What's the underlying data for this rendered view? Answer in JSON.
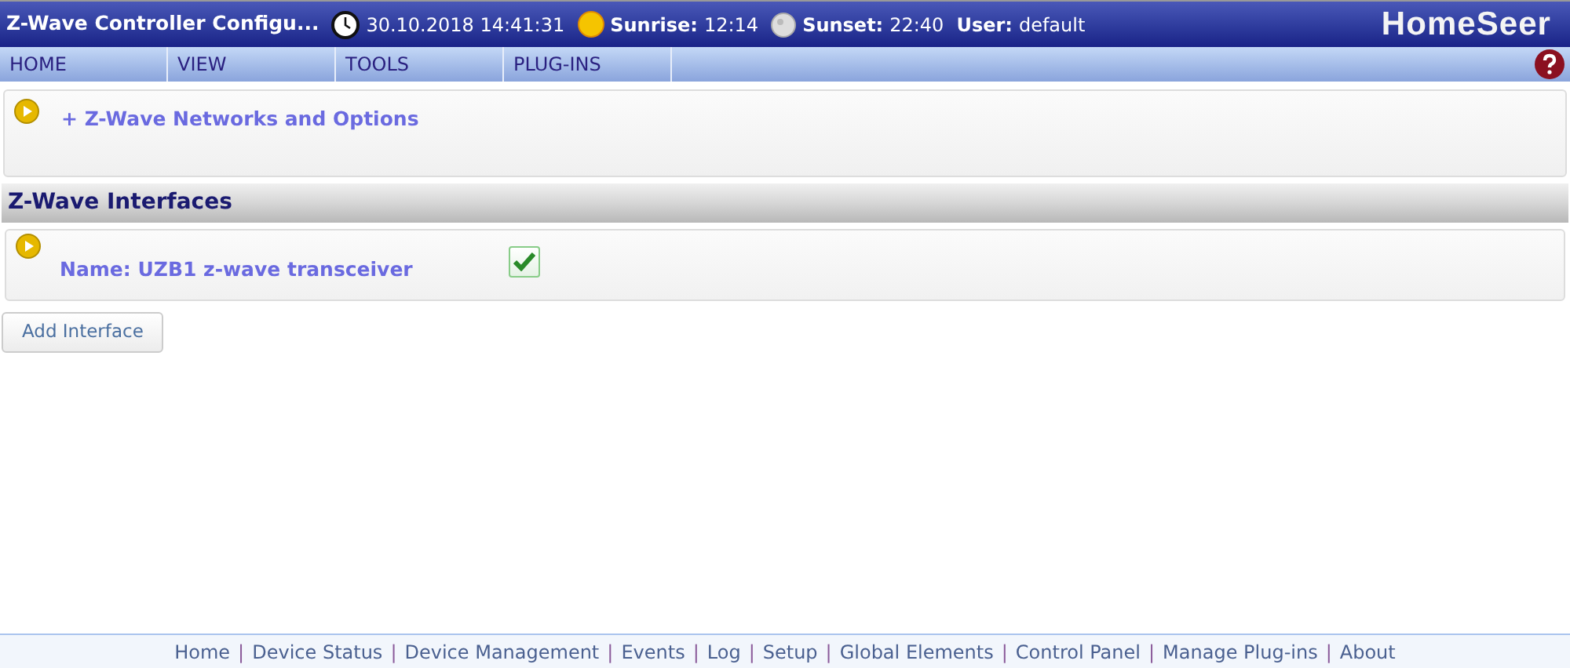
{
  "header": {
    "title": "Z-Wave Controller Configu...",
    "datetime": "30.10.2018 14:41:31",
    "sunrise_label": "Sunrise:",
    "sunrise": "12:14",
    "sunset_label": "Sunset:",
    "sunset": "22:40",
    "user_label": "User:",
    "user": "default",
    "logo": "HomeSeer"
  },
  "menu": [
    {
      "label": "HOME"
    },
    {
      "label": "VIEW"
    },
    {
      "label": "TOOLS"
    },
    {
      "label": "PLUG-INS"
    }
  ],
  "networks_panel": {
    "title": "+ Z-Wave Networks and Options"
  },
  "interfaces_section": {
    "title": "Z-Wave Interfaces"
  },
  "interfaces": [
    {
      "name": "Name: UZB1 z-wave transceiver",
      "checked": true
    }
  ],
  "add_button": "Add Interface",
  "footer": [
    {
      "kind": "link",
      "label": "Home"
    },
    {
      "kind": "separator",
      "label": "|"
    },
    {
      "kind": "link",
      "label": "Device Status"
    },
    {
      "kind": "separator",
      "label": "|"
    },
    {
      "kind": "link",
      "label": "Device Management"
    },
    {
      "kind": "separator",
      "label": "|"
    },
    {
      "kind": "link",
      "label": "Events"
    },
    {
      "kind": "separator",
      "label": "|"
    },
    {
      "kind": "link",
      "label": "Log"
    },
    {
      "kind": "separator",
      "label": "|"
    },
    {
      "kind": "link",
      "label": "Setup"
    },
    {
      "kind": "separator",
      "label": "|"
    },
    {
      "kind": "link",
      "label": "Global Elements"
    },
    {
      "kind": "separator",
      "label": "|"
    },
    {
      "kind": "link",
      "label": "Control Panel"
    },
    {
      "kind": "separator",
      "label": "|"
    },
    {
      "kind": "link",
      "label": "Manage Plug-ins"
    },
    {
      "kind": "separator",
      "label": "|"
    },
    {
      "kind": "link",
      "label": "About"
    }
  ]
}
